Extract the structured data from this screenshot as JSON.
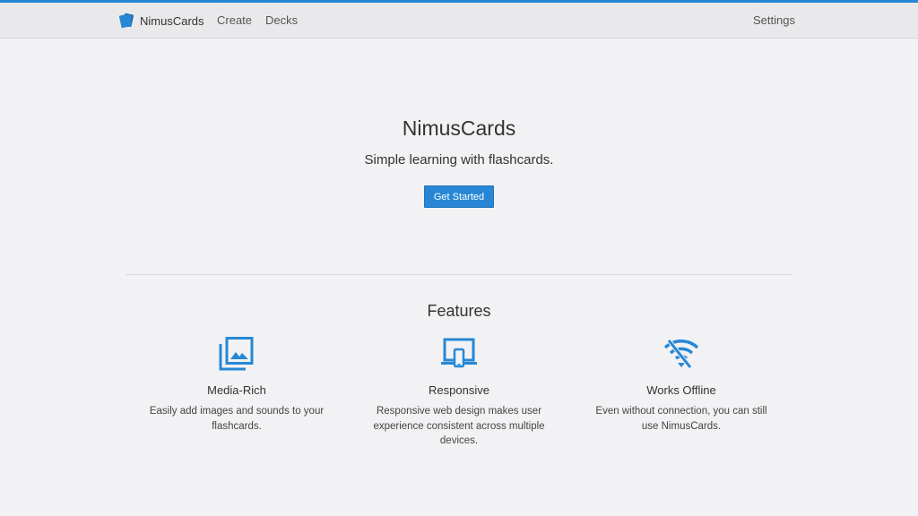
{
  "navbar": {
    "brand": "NimusCards",
    "links": [
      "Create",
      "Decks"
    ],
    "settings": "Settings"
  },
  "hero": {
    "title": "NimusCards",
    "subtitle": "Simple learning with flashcards.",
    "cta": "Get Started"
  },
  "features": {
    "title": "Features",
    "items": [
      {
        "icon": "photo-library-icon",
        "title": "Media-Rich",
        "desc": "Easily add images and sounds to your flashcards."
      },
      {
        "icon": "devices-icon",
        "title": "Responsive",
        "desc": "Responsive web design makes user experience consistent across multiple devices."
      },
      {
        "icon": "wifi-off-icon",
        "title": "Works Offline",
        "desc": "Even without connection, you can still use NimusCards."
      }
    ]
  },
  "colors": {
    "accent": "#2787d6",
    "background": "#f2f2f4",
    "navbar": "#e9e9eb"
  }
}
